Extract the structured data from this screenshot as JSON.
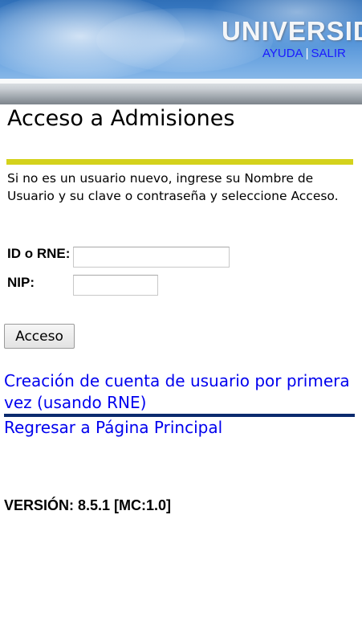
{
  "header": {
    "title": "UNIVERSID",
    "links": [
      {
        "label": "AYUDA"
      },
      {
        "label": "SALIR"
      }
    ],
    "separator": "|"
  },
  "main": {
    "page_title": "Acceso a Admisiones",
    "intro_text": "Si no es un usuario nuevo, ingrese su Nombre de Usuario y su clave o contraseña y seleccione Acceso.",
    "fields": {
      "id_label": "ID o RNE:",
      "id_value": "",
      "nip_label": "NIP:",
      "nip_value": ""
    },
    "submit_label": "Acceso",
    "links": {
      "create_account": "Creación de cuenta de usuario por primera vez (usando RNE)",
      "home": "Regresar a Página Principal"
    },
    "version": "VERSIÓN: 8.5.1 [MC:1.0]"
  },
  "colors": {
    "link": "#0000ee",
    "accent_rule": "#d4d21c",
    "divider_rule": "#0b2a6e"
  }
}
